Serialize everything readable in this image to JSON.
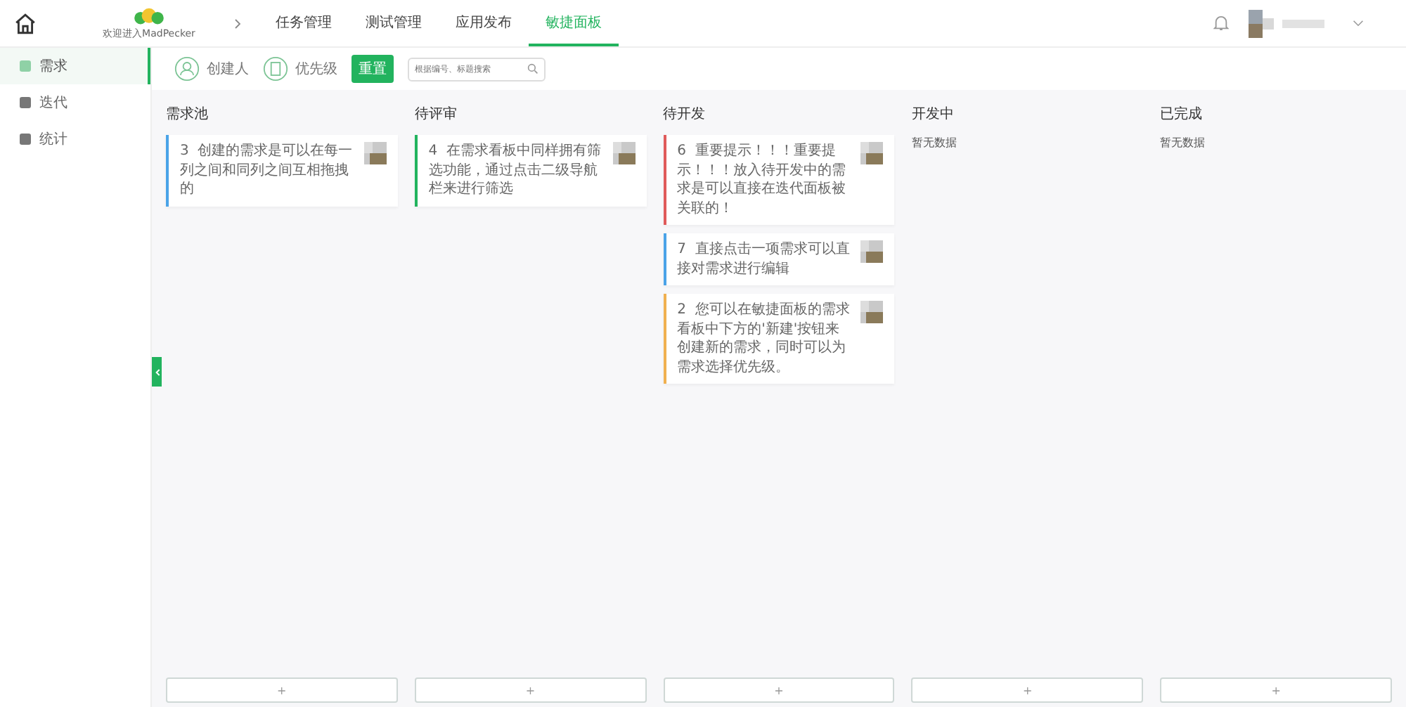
{
  "logo": {
    "caption": "欢迎进入MadPecker"
  },
  "nav": [
    {
      "label": "任务管理",
      "selected": false
    },
    {
      "label": "测试管理",
      "selected": false
    },
    {
      "label": "应用发布",
      "selected": false
    },
    {
      "label": "敏捷面板",
      "selected": true
    }
  ],
  "sidebar": {
    "items": [
      {
        "label": "需求",
        "selected": true
      },
      {
        "label": "迭代",
        "selected": false
      },
      {
        "label": "统计",
        "selected": false
      }
    ]
  },
  "filters": [
    {
      "label": "创建人"
    },
    {
      "label": "优先级"
    }
  ],
  "reset_button": "重置",
  "search": {
    "placeholder": "根据编号、标题搜索"
  },
  "columns": [
    {
      "title": "需求池",
      "add": "+",
      "cards": [
        {
          "id": "3",
          "text": "创建的需求是可以在每一列之间和同列之间互相拖拽的",
          "color": "#4aa3e8"
        }
      ]
    },
    {
      "title": "待评审",
      "add": "+",
      "cards": [
        {
          "id": "4",
          "text": "在需求看板中同样拥有筛选功能，通过点击二级导航栏来进行筛选",
          "color": "#22b35e"
        }
      ]
    },
    {
      "title": "待开发",
      "add": "+",
      "cards": [
        {
          "id": "6",
          "text": "重要提示！！！重要提示！！！放入待开发中的需求是可以直接在迭代面板被关联的！",
          "color": "#e05a5a"
        },
        {
          "id": "7",
          "text": "直接点击一项需求可以直接对需求进行编辑",
          "color": "#4aa3e8"
        },
        {
          "id": "2",
          "text": "您可以在敏捷面板的需求看板中下方的'新建'按钮来创建新的需求，同时可以为需求选择优先级。",
          "color": "#f0b050"
        }
      ]
    },
    {
      "title": "开发中",
      "empty_text": "暂无数据",
      "add": "+"
    },
    {
      "title": "已完成",
      "empty_text": "暂无数据",
      "add": "+"
    }
  ]
}
